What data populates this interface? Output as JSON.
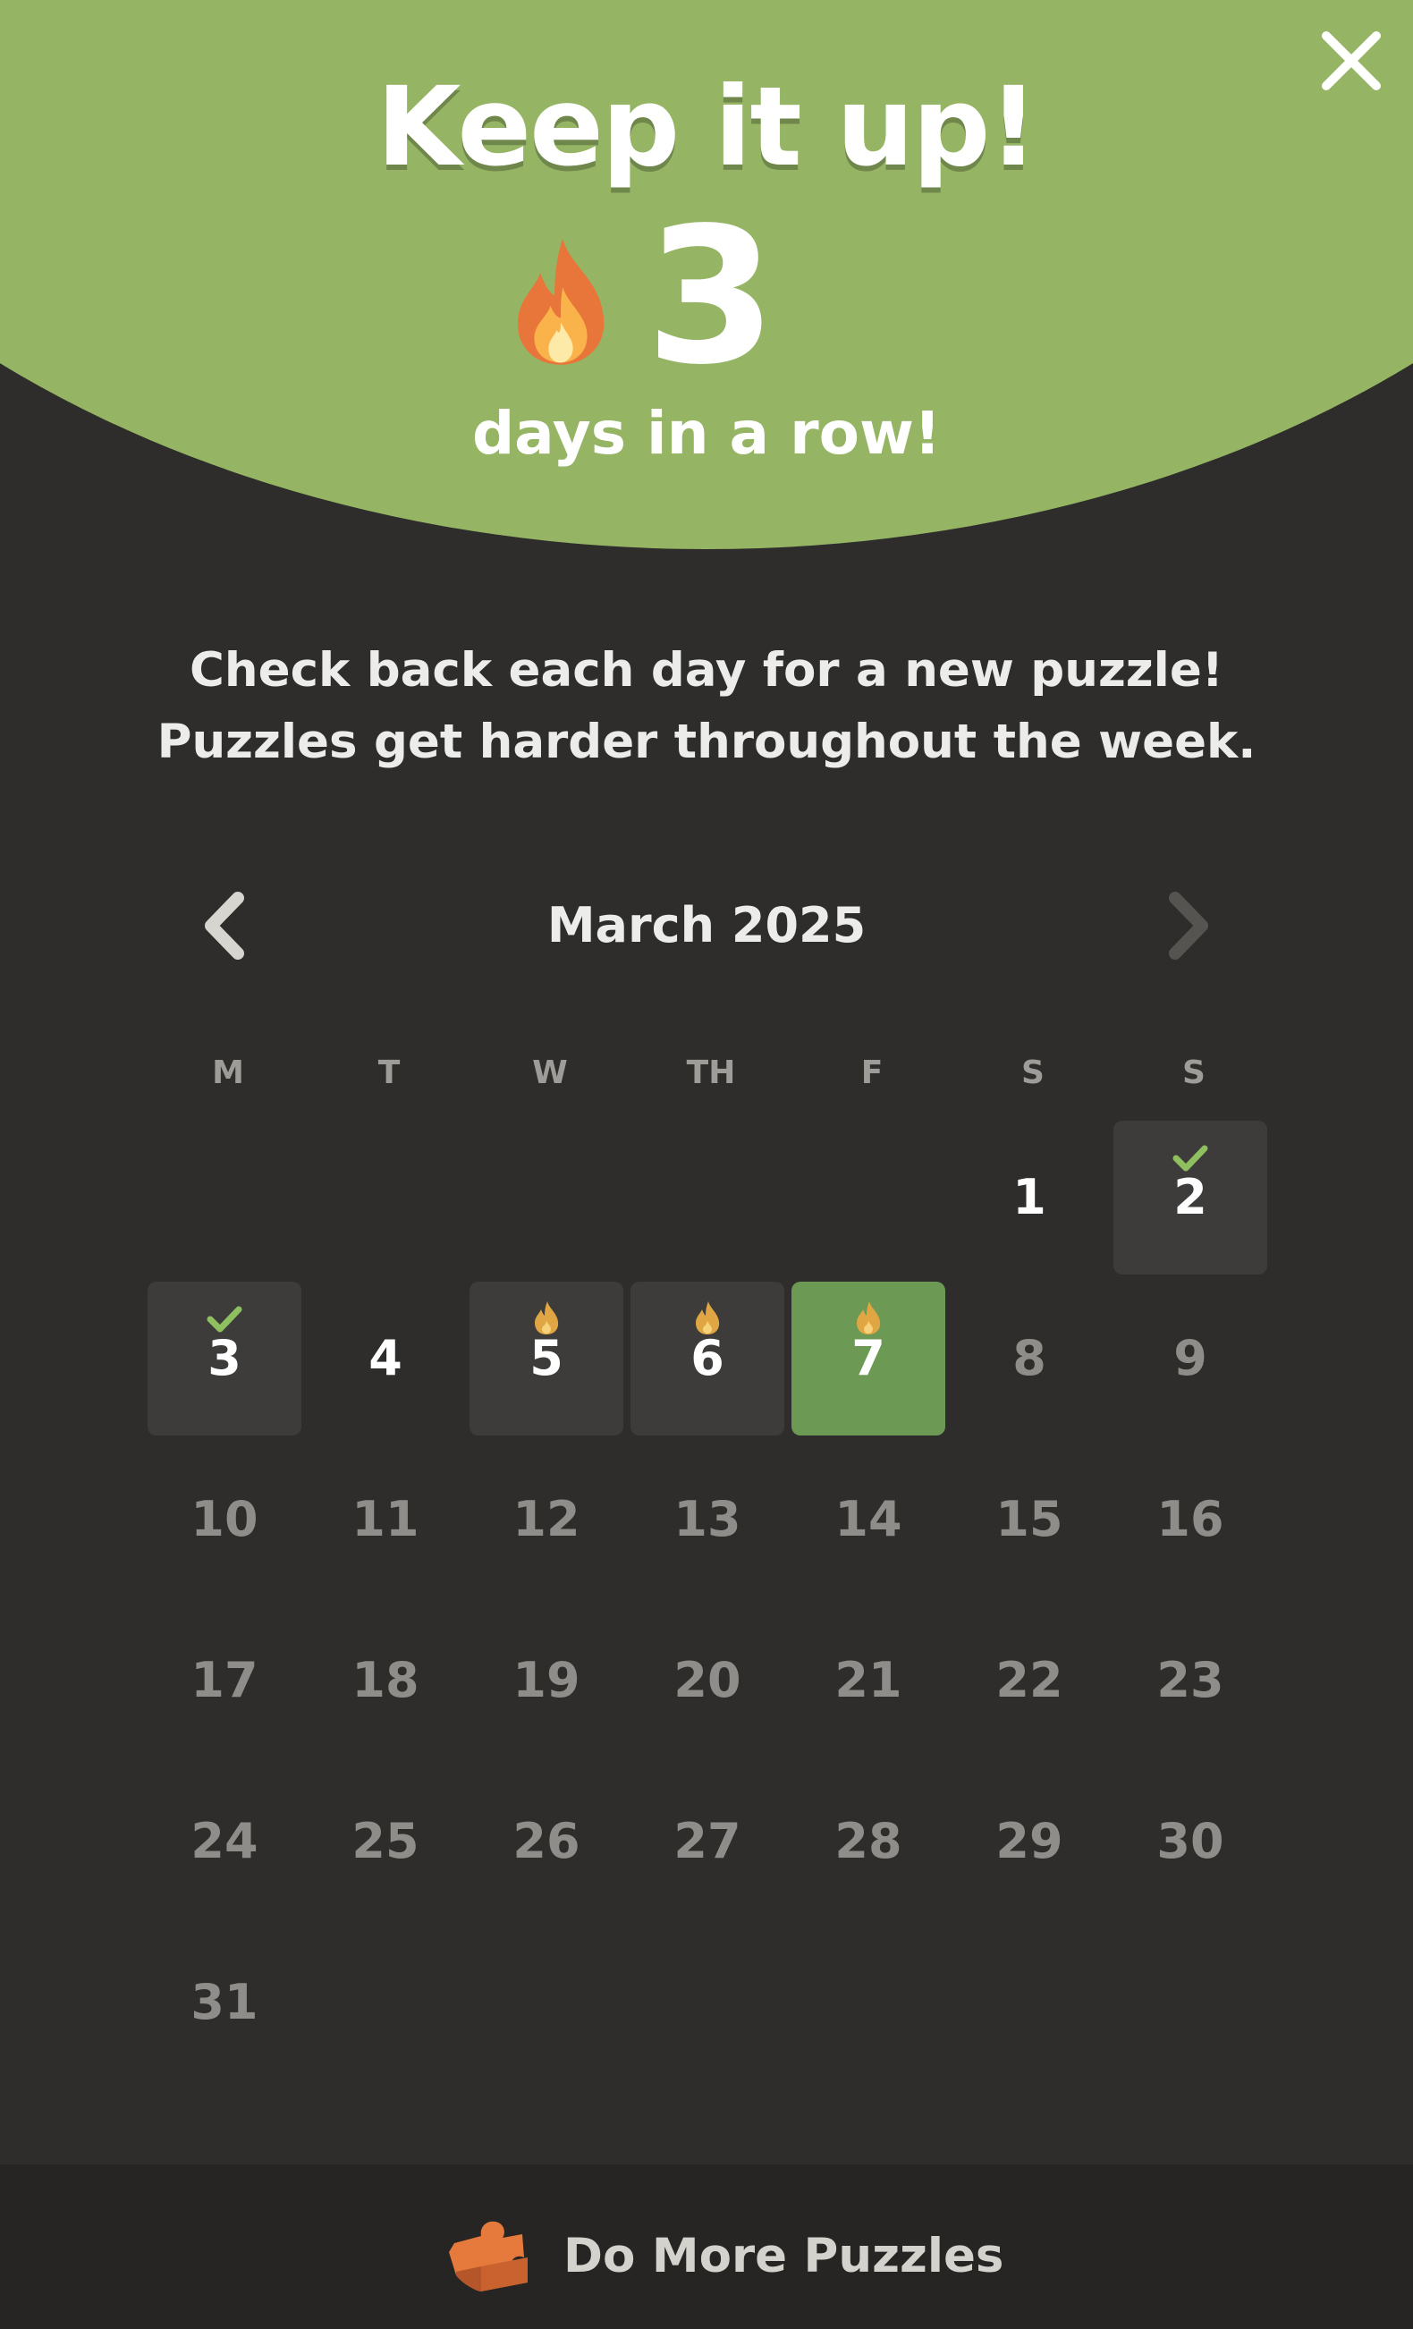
{
  "header": {
    "title": "Keep it up!",
    "streak_count": "3",
    "streak_label": "days in a row!",
    "background_color": "#95b564",
    "flame_icon": "fire-icon"
  },
  "close_icon": "close-icon",
  "info": {
    "line1": "Check back each day for a new puzzle!",
    "line2": "Puzzles get harder throughout the week."
  },
  "calendar": {
    "month_label": "March 2025",
    "prev_icon": "chevron-left-icon",
    "next_icon": "chevron-right-icon",
    "weekdays": [
      "M",
      "T",
      "W",
      "TH",
      "F",
      "S",
      "S"
    ],
    "days": [
      {
        "label": "",
        "state": "empty",
        "mark": ""
      },
      {
        "label": "",
        "state": "empty",
        "mark": ""
      },
      {
        "label": "",
        "state": "empty",
        "mark": ""
      },
      {
        "label": "",
        "state": "empty",
        "mark": ""
      },
      {
        "label": "",
        "state": "empty",
        "mark": ""
      },
      {
        "label": "1",
        "state": "available",
        "mark": ""
      },
      {
        "label": "2",
        "state": "played",
        "mark": "check"
      },
      {
        "label": "3",
        "state": "played",
        "mark": "check"
      },
      {
        "label": "4",
        "state": "available",
        "mark": ""
      },
      {
        "label": "5",
        "state": "played",
        "mark": "flame"
      },
      {
        "label": "6",
        "state": "played",
        "mark": "flame"
      },
      {
        "label": "7",
        "state": "today",
        "mark": "flame"
      },
      {
        "label": "8",
        "state": "future",
        "mark": ""
      },
      {
        "label": "9",
        "state": "future",
        "mark": ""
      },
      {
        "label": "10",
        "state": "future",
        "mark": ""
      },
      {
        "label": "11",
        "state": "future",
        "mark": ""
      },
      {
        "label": "12",
        "state": "future",
        "mark": ""
      },
      {
        "label": "13",
        "state": "future",
        "mark": ""
      },
      {
        "label": "14",
        "state": "future",
        "mark": ""
      },
      {
        "label": "15",
        "state": "future",
        "mark": ""
      },
      {
        "label": "16",
        "state": "future",
        "mark": ""
      },
      {
        "label": "17",
        "state": "future",
        "mark": ""
      },
      {
        "label": "18",
        "state": "future",
        "mark": ""
      },
      {
        "label": "19",
        "state": "future",
        "mark": ""
      },
      {
        "label": "20",
        "state": "future",
        "mark": ""
      },
      {
        "label": "21",
        "state": "future",
        "mark": ""
      },
      {
        "label": "22",
        "state": "future",
        "mark": ""
      },
      {
        "label": "23",
        "state": "future",
        "mark": ""
      },
      {
        "label": "24",
        "state": "future",
        "mark": ""
      },
      {
        "label": "25",
        "state": "future",
        "mark": ""
      },
      {
        "label": "26",
        "state": "future",
        "mark": ""
      },
      {
        "label": "27",
        "state": "future",
        "mark": ""
      },
      {
        "label": "28",
        "state": "future",
        "mark": ""
      },
      {
        "label": "29",
        "state": "future",
        "mark": ""
      },
      {
        "label": "30",
        "state": "future",
        "mark": ""
      },
      {
        "label": "31",
        "state": "future",
        "mark": ""
      }
    ],
    "colors": {
      "played_bg": "#3d3c3a",
      "today_bg": "#6c9a55",
      "check": "#8fc05f",
      "flame": "#e0a644"
    }
  },
  "footer": {
    "button_label": "Do More Puzzles",
    "icon": "puzzle-piece-icon"
  }
}
